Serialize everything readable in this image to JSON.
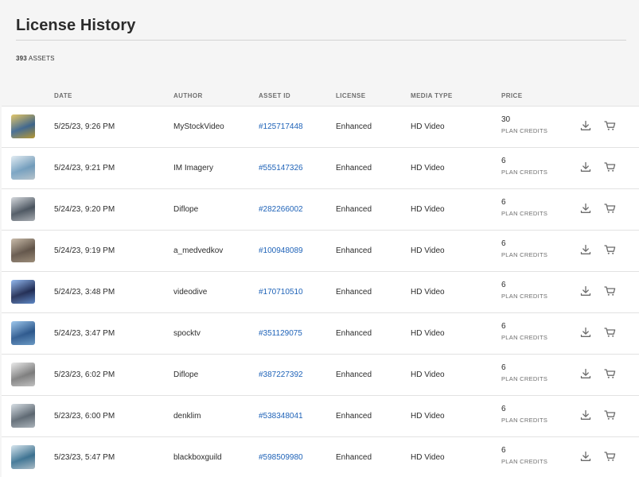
{
  "page": {
    "title": "License History",
    "asset_count": "393",
    "asset_count_suffix": " ASSETS"
  },
  "table": {
    "headers": {
      "date": "DATE",
      "author": "AUTHOR",
      "asset_id": "ASSET ID",
      "license": "LICENSE",
      "media_type": "MEDIA TYPE",
      "price": "PRICE"
    },
    "rows": [
      {
        "date": "5/25/23, 9:26 PM",
        "author": "MyStockVideo",
        "asset_id": "#125717448",
        "license": "Enhanced",
        "media_type": "HD Video",
        "price": "30",
        "price_unit": "PLAN CREDITS",
        "thumb_colors": [
          "#2f5f8f",
          "#d9b43a"
        ]
      },
      {
        "date": "5/24/23, 9:21 PM",
        "author": "IM Imagery",
        "asset_id": "#555147326",
        "license": "Enhanced",
        "media_type": "HD Video",
        "price": "6",
        "price_unit": "PLAN CREDITS",
        "thumb_colors": [
          "#6fa3c9",
          "#d8e6ef"
        ]
      },
      {
        "date": "5/24/23, 9:20 PM",
        "author": "Diflope",
        "asset_id": "#282266002",
        "license": "Enhanced",
        "media_type": "HD Video",
        "price": "6",
        "price_unit": "PLAN CREDITS",
        "thumb_colors": [
          "#3f4b58",
          "#c7ccd2"
        ]
      },
      {
        "date": "5/24/23, 9:19 PM",
        "author": "a_medvedkov",
        "asset_id": "#100948089",
        "license": "Enhanced",
        "media_type": "HD Video",
        "price": "6",
        "price_unit": "PLAN CREDITS",
        "thumb_colors": [
          "#5a4a3c",
          "#b7a58e"
        ]
      },
      {
        "date": "5/24/23, 3:48 PM",
        "author": "videodive",
        "asset_id": "#170710510",
        "license": "Enhanced",
        "media_type": "HD Video",
        "price": "6",
        "price_unit": "PLAN CREDITS",
        "thumb_colors": [
          "#0c1a4a",
          "#6fa0e8"
        ]
      },
      {
        "date": "5/24/23, 3:47 PM",
        "author": "spocktv",
        "asset_id": "#351129075",
        "license": "Enhanced",
        "media_type": "HD Video",
        "price": "6",
        "price_unit": "PLAN CREDITS",
        "thumb_colors": [
          "#1a4f8f",
          "#7db4e6"
        ]
      },
      {
        "date": "5/23/23, 6:02 PM",
        "author": "Diflope",
        "asset_id": "#387227392",
        "license": "Enhanced",
        "media_type": "HD Video",
        "price": "6",
        "price_unit": "PLAN CREDITS",
        "thumb_colors": [
          "#7c7c7c",
          "#e3e3e3"
        ]
      },
      {
        "date": "5/23/23, 6:00 PM",
        "author": "denklim",
        "asset_id": "#538348041",
        "license": "Enhanced",
        "media_type": "HD Video",
        "price": "6",
        "price_unit": "PLAN CREDITS",
        "thumb_colors": [
          "#55626e",
          "#c9d3db"
        ]
      },
      {
        "date": "5/23/23, 5:47 PM",
        "author": "blackboxguild",
        "asset_id": "#598509980",
        "license": "Enhanced",
        "media_type": "HD Video",
        "price": "6",
        "price_unit": "PLAN CREDITS",
        "thumb_colors": [
          "#2d6e94",
          "#c9dde9"
        ]
      }
    ]
  },
  "icons": {
    "download": "download-icon",
    "cart": "cart-icon"
  },
  "colors": {
    "link": "#1f63b8",
    "background": "#f5f5f5",
    "row_background": "#ffffff"
  }
}
